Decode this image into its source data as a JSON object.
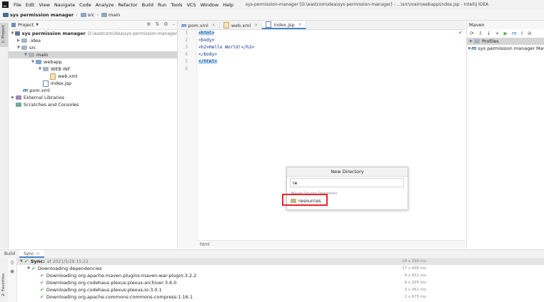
{
  "menu": {
    "items": [
      "File",
      "Edit",
      "View",
      "Navigate",
      "Code",
      "Analyze",
      "Refactor",
      "Build",
      "Run",
      "Tools",
      "VCS",
      "Window",
      "Help"
    ],
    "title": "sys-permission-manager [D:\\eastcom\\idea\\sys-permission-manager] - ...\\src\\main\\webapp\\index.jsp - IntelliJ IDEA"
  },
  "breadcrumbs": [
    "sys permission manager",
    "src",
    "main"
  ],
  "left_stripe": {
    "project_tab": "1: Project"
  },
  "project": {
    "header": "Project",
    "tree": [
      {
        "label": "sys permission manager",
        "extra": "D:\\eastcom\\idea\\sys-permission-manager"
      },
      {
        "label": ".idea"
      },
      {
        "label": "src"
      },
      {
        "label": "main"
      },
      {
        "label": "webapp"
      },
      {
        "label": "WEB INF"
      },
      {
        "label": "web.xml"
      },
      {
        "label": "index.jsp"
      },
      {
        "label": "pom.xml"
      },
      {
        "label": "External Libraries"
      },
      {
        "label": "Scratches and Consoles"
      }
    ]
  },
  "editor": {
    "tabs": [
      {
        "label": "pom.xml"
      },
      {
        "label": "web.xml"
      },
      {
        "label": "index.jsp"
      }
    ],
    "line_numbers": [
      "1",
      "2",
      "3",
      "4",
      "5",
      "6"
    ],
    "code": [
      "<html>",
      "<body>",
      "<h2>Hello World!</h2>",
      "</body>",
      "</html>",
      ""
    ],
    "breadcrumb": "html"
  },
  "maven": {
    "title": "Maven",
    "items": [
      "Profiles",
      "sys permission manager Mav"
    ]
  },
  "dialog": {
    "title": "New Directory",
    "input_value": "re",
    "section": "Maven Source Directories",
    "item": "resources"
  },
  "bottom": {
    "tabs": [
      "Build",
      "Sync"
    ],
    "stripe_label": "2: Favorites",
    "rows": [
      {
        "text": "Sync:",
        "sub": "at 2021/5/28 15:22",
        "dur": "19 s 290 ms"
      },
      {
        "text": "Downloading dependencies",
        "sub": "",
        "dur": "17 s 408 ms"
      },
      {
        "text": "Downloading org.apache.maven.plugins:maven-war-plugin:3.2.2",
        "sub": "",
        "dur": "4 s 821 ms"
      },
      {
        "text": "Downloading org.codehaus.plexus:plexus-archiver:3.6.0",
        "sub": "",
        "dur": "4 s 205 ms"
      },
      {
        "text": "Downloading org.codehaus.plexus:plexus-io:3.0.1",
        "sub": "",
        "dur": "3 s 051 ms"
      },
      {
        "text": "Downloading org.apache.commons:commons-compress:1.16.1",
        "sub": "",
        "dur": "2 s 675 ms"
      }
    ]
  }
}
